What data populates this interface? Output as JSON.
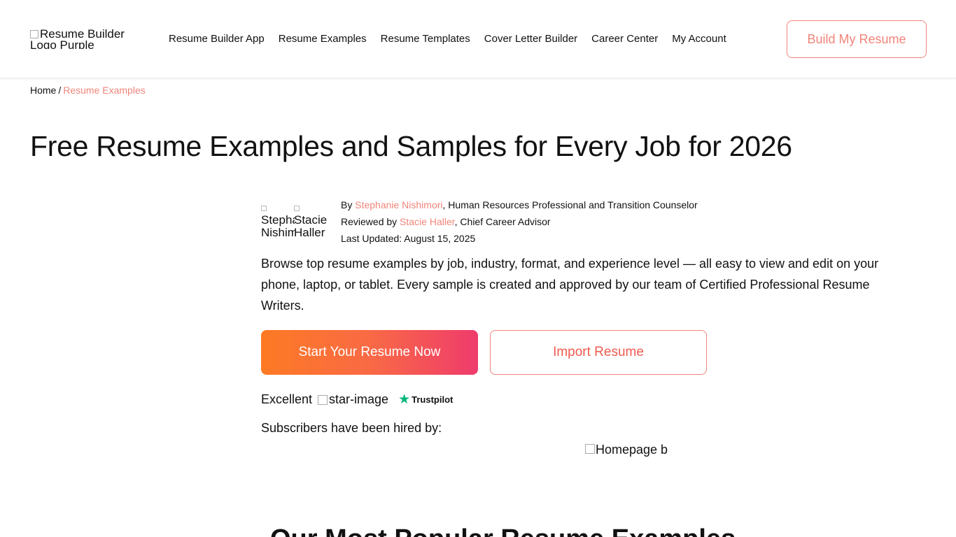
{
  "header": {
    "logo_alt": "Resume Builder Logo Purple",
    "nav": [
      {
        "label": "Resume Builder App"
      },
      {
        "label": "Resume Examples"
      },
      {
        "label": "Resume Templates"
      },
      {
        "label": "Cover Letter Builder"
      },
      {
        "label": "Career Center"
      },
      {
        "label": "My Account"
      }
    ],
    "cta_label": "Build My Resume"
  },
  "breadcrumb": {
    "home": "Home",
    "separator": "/",
    "current": "Resume Examples"
  },
  "page_title": "Free Resume Examples and Samples for Every Job for 2026",
  "authors": {
    "avatar1_alt": "Stephanie Nishimori",
    "avatar2_alt": "Stacie Haller",
    "by_prefix": "By",
    "author_name": "Stephanie Nishimori",
    "author_title": ", Human Resources Professional and Transition Counselor",
    "reviewed_prefix": "Reviewed by",
    "reviewer_name": "Stacie Haller",
    "reviewer_title": ", Chief Career Advisor",
    "updated_label": "Last Updated:",
    "updated_date": "August 15, 2025"
  },
  "intro": "Browse top resume examples by job, industry, format, and experience level — all easy to view and edit on your phone, laptop, or tablet. Every sample is created and approved by our team of Certified Professional Resume Writers.",
  "buttons": {
    "start": "Start Your Resume Now",
    "import": "Import Resume"
  },
  "rating": {
    "label": "Excellent",
    "star_image_alt": "star-image",
    "trustpilot": "Trustpilot"
  },
  "hired_text": "Subscribers have been hired by:",
  "homepage_image_alt": "Homepage b",
  "section_title": "Our Most Popular Resume Examples",
  "colors": {
    "accent": "#f0857a",
    "gradient_start": "#fd7a23",
    "gradient_end": "#ef3b6c",
    "trustpilot_green": "#00b67a"
  }
}
